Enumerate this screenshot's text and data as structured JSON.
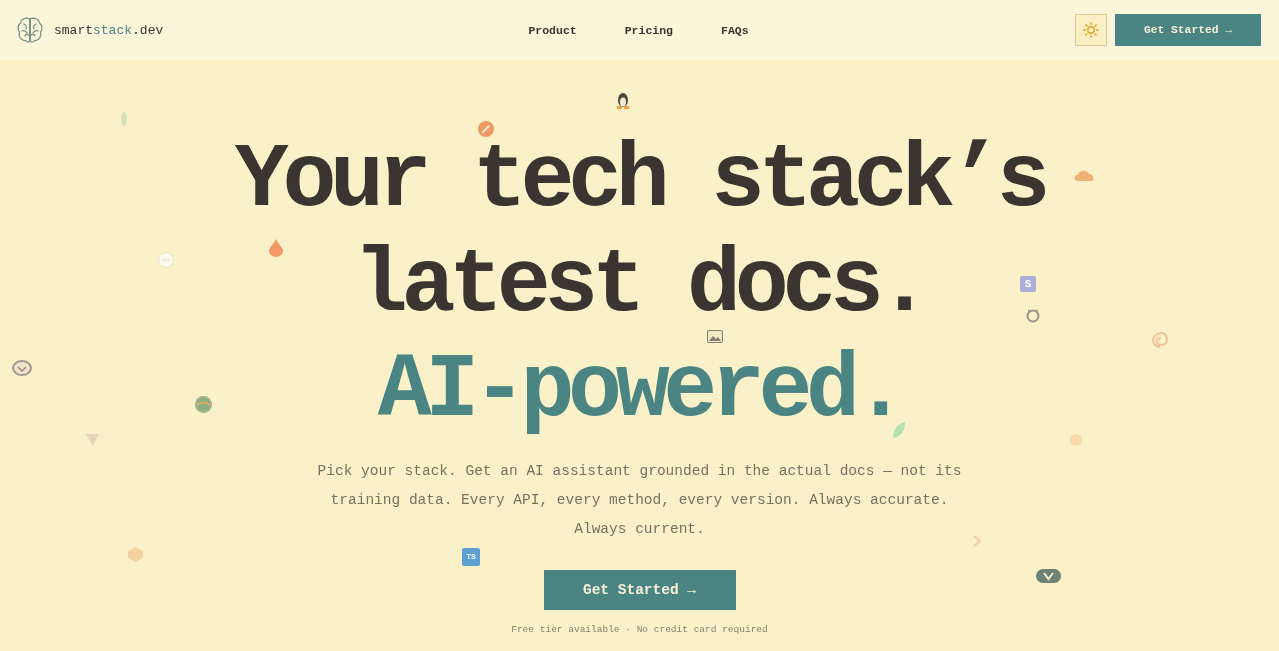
{
  "header": {
    "logo": {
      "parts": [
        {
          "text": "smart",
          "accent": false
        },
        {
          "text": "stack",
          "accent": true
        },
        {
          "text": ".dev",
          "accent": false
        }
      ]
    },
    "nav": [
      "Product",
      "Pricing",
      "FAQs"
    ],
    "cta": "Get Started →"
  },
  "hero": {
    "headline": [
      {
        "text": "Your tech stack’s",
        "accent": false
      },
      {
        "text": "latest docs.",
        "accent": false
      },
      {
        "text": "AI-powered.",
        "accent": true
      }
    ],
    "subtitle": "Pick your stack. Get an AI assistant grounded in the actual docs — not its training data. Every API, every method, every version. Always accurate. Always current.",
    "cta": "Get Started →",
    "note": "Free tier available · No credit card required",
    "floating_tiles": [
      {
        "text": "S",
        "color": "#aab0d8"
      },
      {
        "text": "TS",
        "color": "#5d9fd2"
      }
    ]
  }
}
